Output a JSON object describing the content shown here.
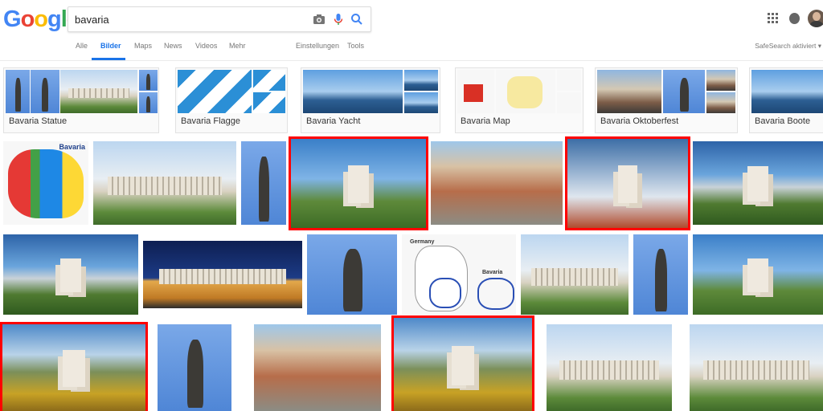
{
  "header": {
    "logo": [
      "G",
      "o",
      "o",
      "g",
      "l",
      "e"
    ],
    "logo_colors": [
      "#4285f4",
      "#ea4335",
      "#fbbc05",
      "#4285f4",
      "#34a853",
      "#ea4335"
    ],
    "search_value": "bavaria",
    "icons": [
      "camera-icon",
      "microphone-icon",
      "search-icon",
      "apps-icon",
      "notifications-icon",
      "avatar"
    ]
  },
  "tabs": [
    "Alle",
    "Bilder",
    "Maps",
    "News",
    "Videos",
    "Mehr"
  ],
  "active_tab": "Bilder",
  "tools": [
    "Einstellungen",
    "Tools"
  ],
  "safesearch": "SafeSearch aktiviert",
  "related": [
    {
      "label": "Bavaria Statue"
    },
    {
      "label": "Bavaria Flagge"
    },
    {
      "label": "Bavaria Yacht"
    },
    {
      "label": "Bavaria Map"
    },
    {
      "label": "Bavaria Oktoberfest"
    },
    {
      "label": "Bavaria Boote"
    }
  ],
  "map_label": "Bavaria",
  "germany_label": "Germany",
  "map_label2": "Bavaria",
  "accent_color": "#1a73e8",
  "highlight_color": "#ff0000"
}
